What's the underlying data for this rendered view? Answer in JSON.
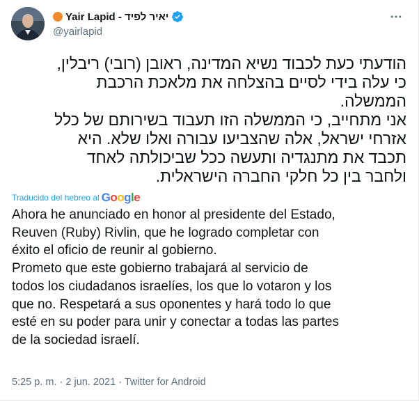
{
  "author": {
    "display_name": "Yair Lapid - יאיר לפיד",
    "handle": "@yairlapid"
  },
  "icons": {
    "verified": "verified-badge-icon",
    "more": "more-options-icon",
    "status_dot": "orange-circle-icon"
  },
  "tweet": {
    "original_lines": [
      "הודעתי כעת לכבוד נשיא המדינה, ראובן (רובי) ריבלין,",
      "כי עלה בידי לסיים בהצלחה את מלאכת הרכבת",
      "הממשלה.",
      "אני מתחייב, כי הממשלה הזו תעבוד בשירותם של כלל",
      "אזרחי ישראל, אלה שהצביעו עבורה ואלו שלא. היא",
      "תכבד את מתנגדיה ותעשה ככל שביכולתה לאחד",
      "ולחבר בין כל חלקי החברה הישראלית."
    ],
    "translated_label": "Traducido del hebreo al",
    "translator_brand": "Google",
    "translation_lines": [
      "Ahora he anunciado en honor al presidente del Estado,",
      "Reuven (Ruby) Rivlin, que he logrado completar con",
      "éxito el oficio de reunir al gobierno.",
      " Prometo que este gobierno trabajará al servicio de",
      "todos los ciudadanos israelíes, los que lo votaron y los",
      "que no. Respetará a sus oponentes y hará todo lo que",
      "esté en su poder para unir y conectar a todas las partes",
      "de la sociedad israelí."
    ]
  },
  "meta": {
    "time": "5:25 p. m.",
    "separator": "·",
    "date": "2 jun. 2021",
    "source": "Twitter for Android"
  },
  "colors": {
    "link_blue": "#1da1f2",
    "secondary_text": "#5b7083",
    "status_orange": "#f28c28"
  }
}
